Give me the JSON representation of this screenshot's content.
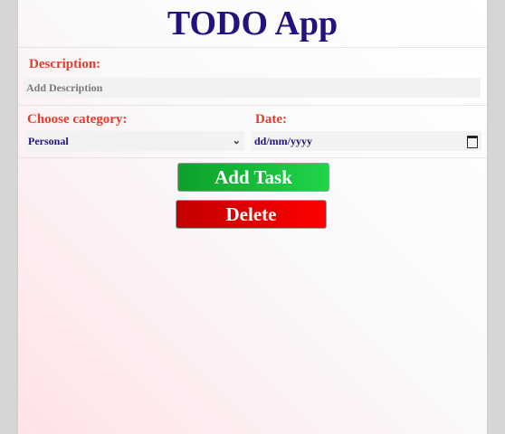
{
  "app": {
    "title": "TODO App"
  },
  "form": {
    "description": {
      "label": "Description:",
      "placeholder": "Add Description",
      "value": ""
    },
    "category": {
      "label": "Choose category:",
      "selected": "Personal"
    },
    "date": {
      "label": "Date:",
      "placeholder": "dd/mm/yyyy",
      "value": ""
    }
  },
  "buttons": {
    "add_label": "Add Task",
    "delete_label": "Delete"
  },
  "colors": {
    "title": "#22127e",
    "label": "#e63b2e",
    "add_button": "#1fd54a",
    "delete_button": "#ff0000"
  },
  "icons": {
    "select": "chevron-down-icon",
    "date": "calendar-icon"
  }
}
